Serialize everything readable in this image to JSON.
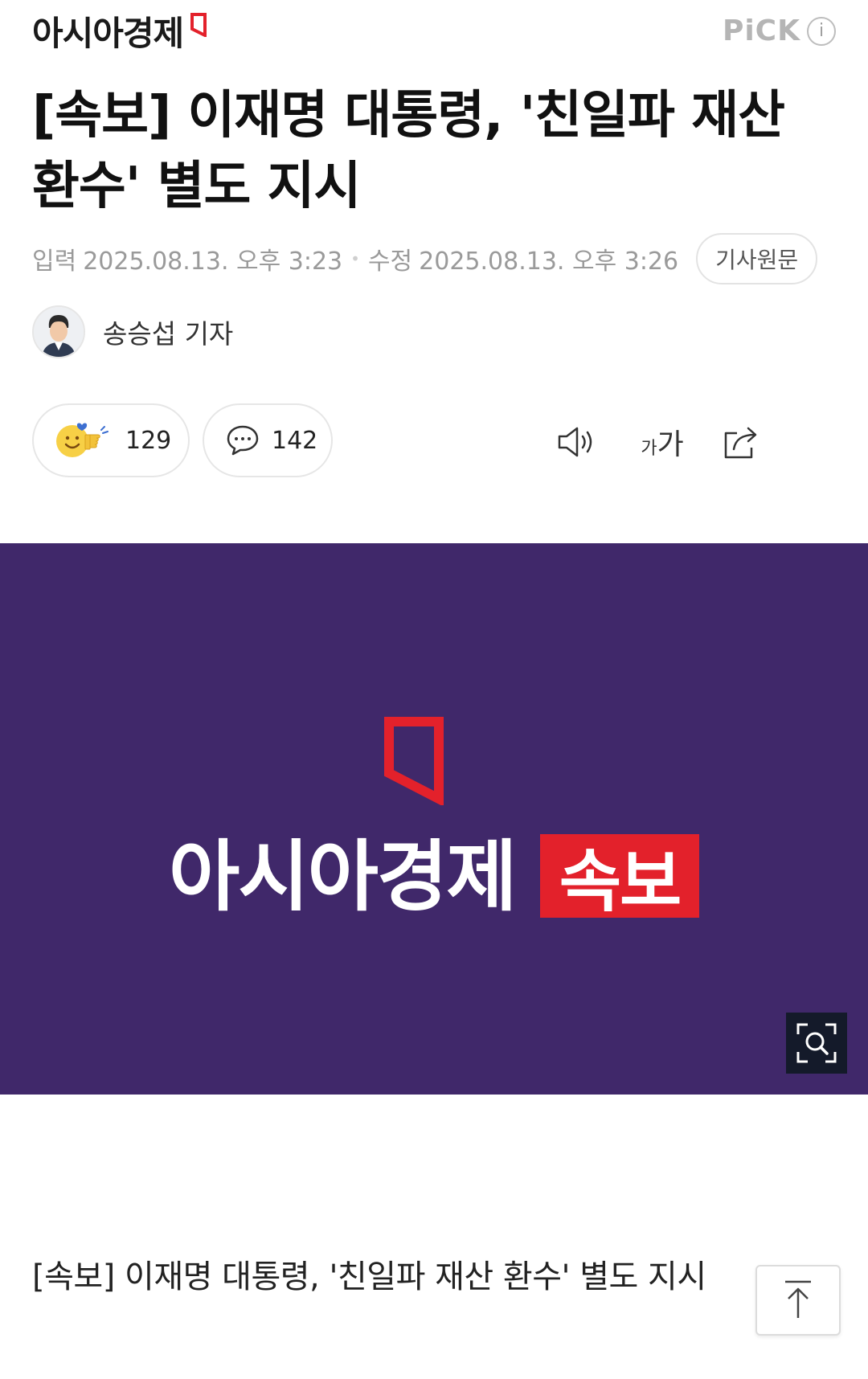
{
  "header": {
    "logo_text": "아시아경제",
    "pick_label": "PiCK",
    "pick_info_glyph": "i"
  },
  "article": {
    "title": "[속보] 이재명 대통령, '친일파 재산 환수' 별도 지시",
    "published_label": "입력",
    "published_value": "2025.08.13. 오후 3:23",
    "modified_label": "수정",
    "modified_value": "2025.08.13. 오후 3:26",
    "original_button": "기사원문",
    "reporter": "송승섭 기자"
  },
  "actions": {
    "reaction_count": "129",
    "comment_count": "142",
    "font_size_label": "가가"
  },
  "hero": {
    "brand_text": "아시아경제",
    "badge_text": "속보",
    "background_color": "#40286a",
    "badge_color": "#e3212b"
  },
  "caption": "[속보] 이재명 대통령, '친일파 재산 환수' 별도 지시",
  "icons": {
    "logo_mark": "red-frame-icon",
    "info": "info-icon",
    "reaction": "emoji-reaction-icon",
    "comment": "comment-bubble-icon",
    "speaker": "speaker-icon",
    "font_size": "font-size-icon",
    "share": "share-icon",
    "zoom": "zoom-icon",
    "scroll_top": "arrow-up-icon"
  }
}
